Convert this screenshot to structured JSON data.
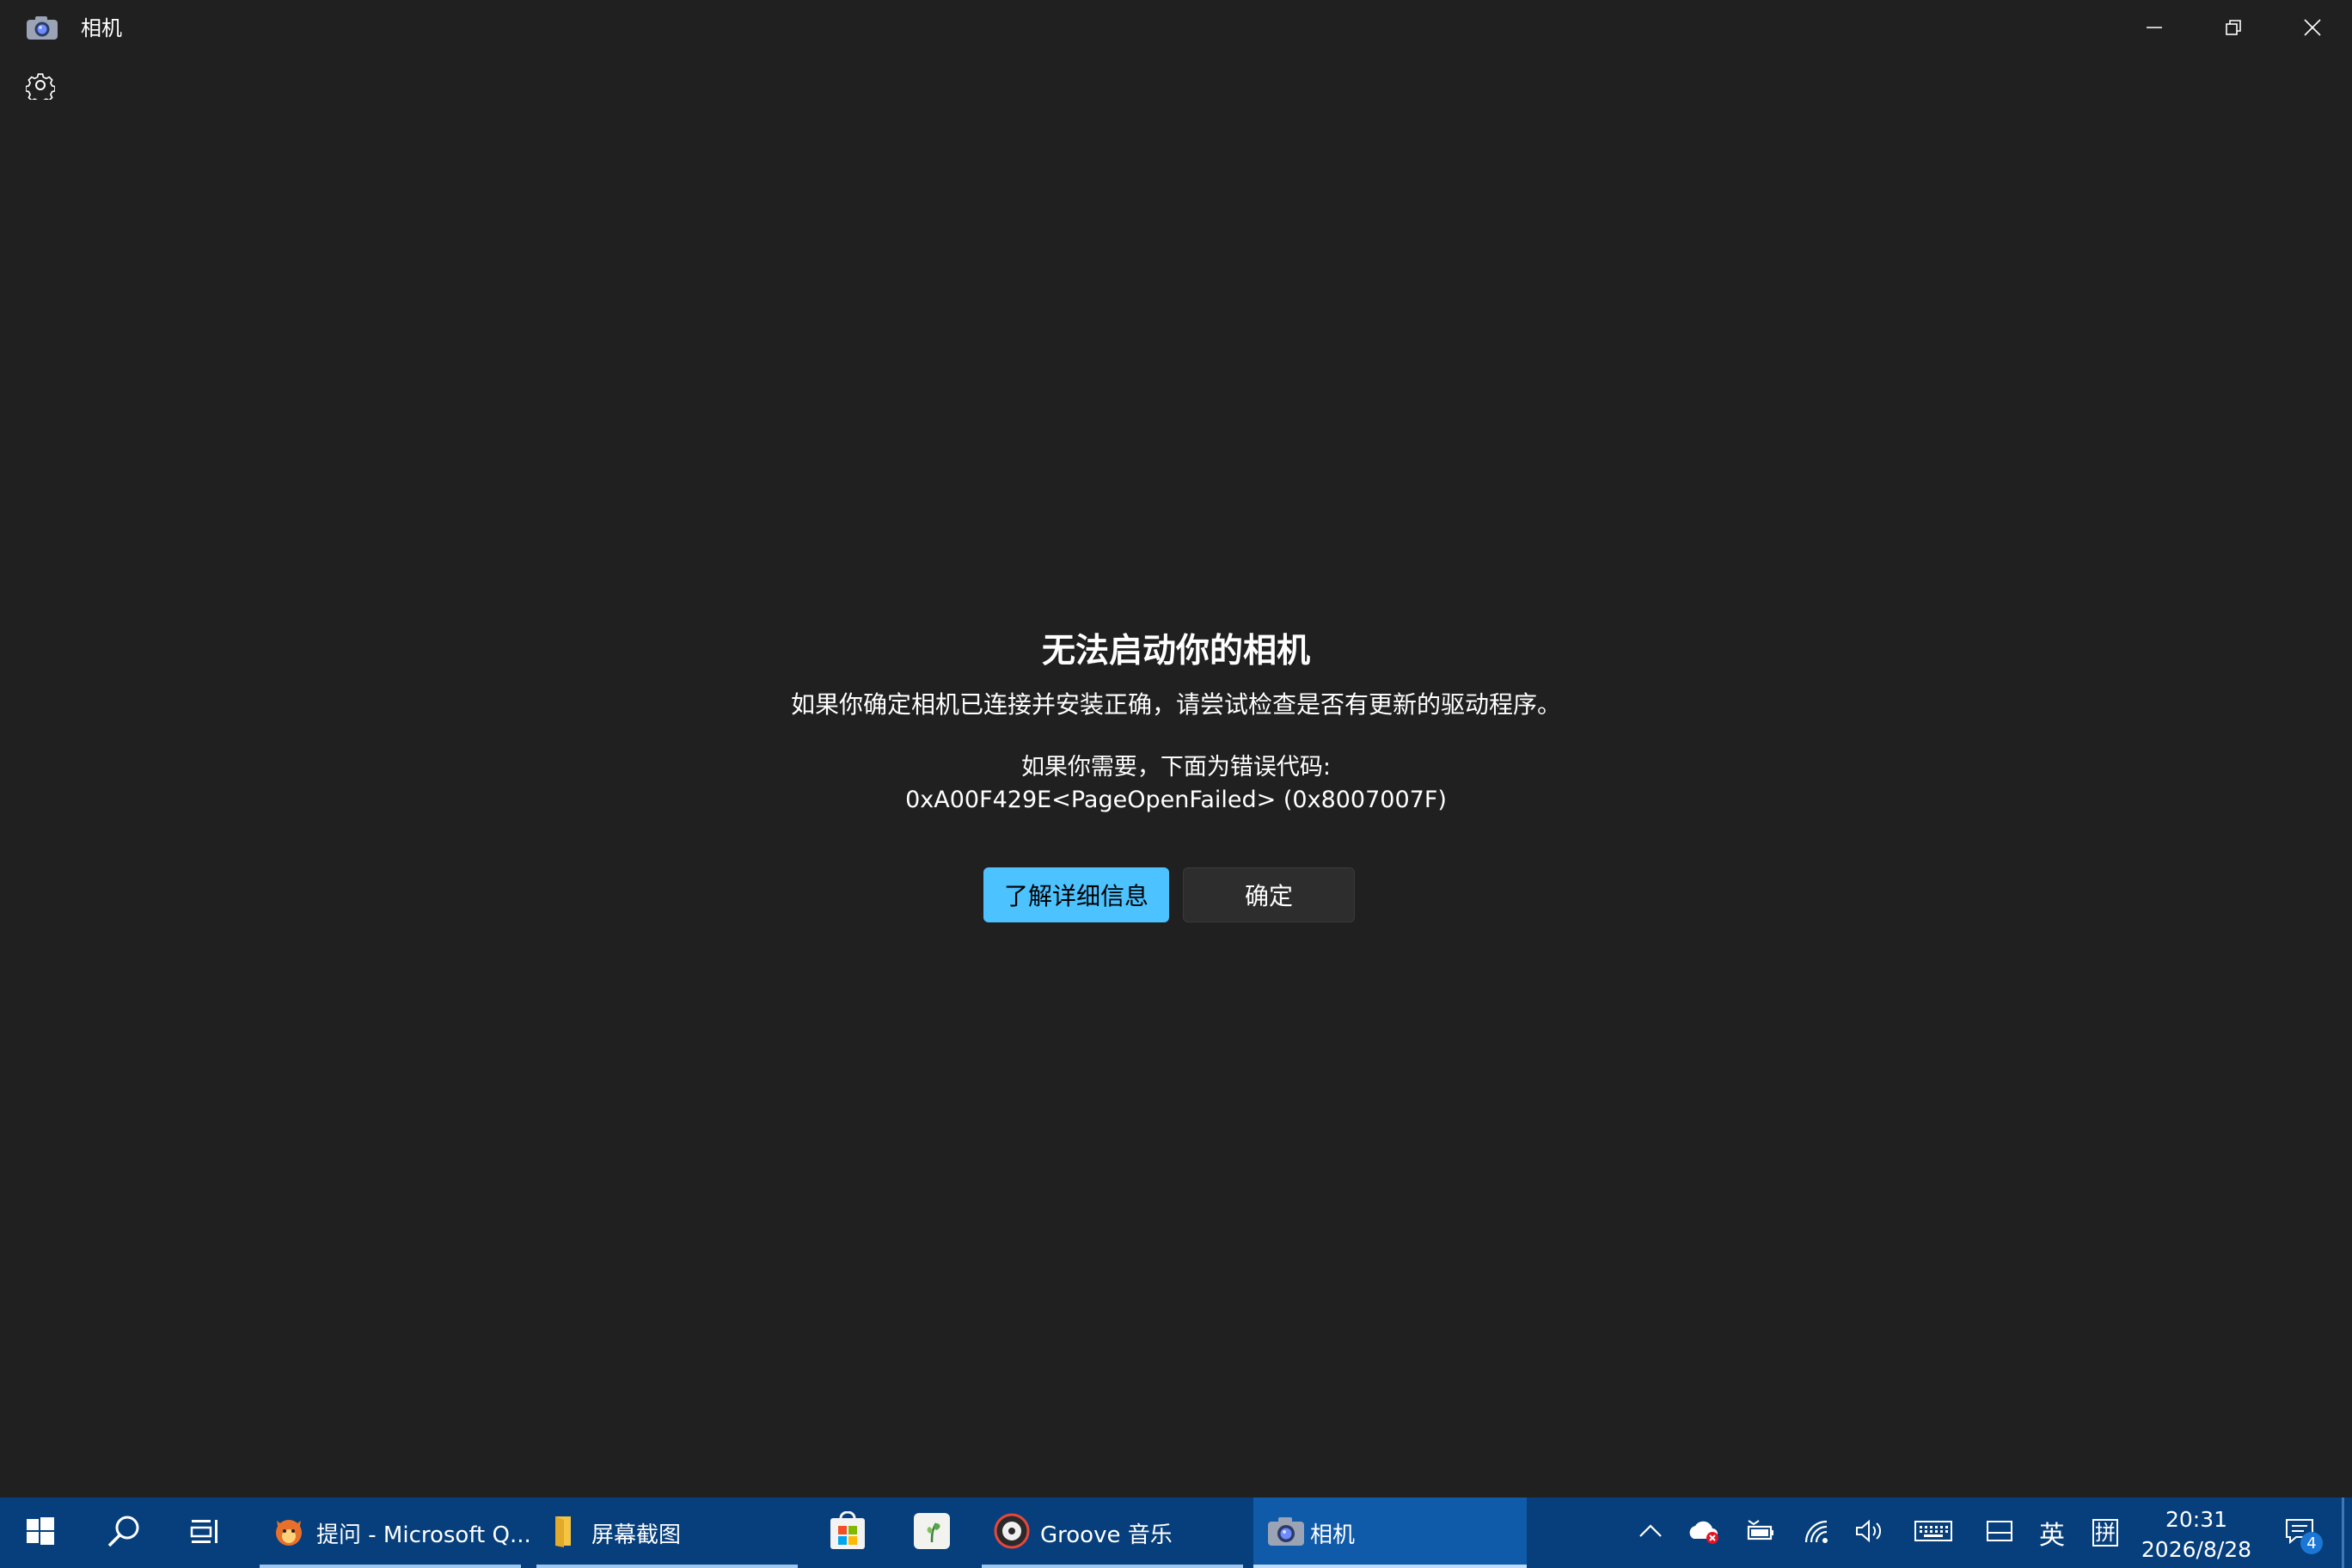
{
  "window": {
    "title": "相机",
    "minimize_icon": "minimize-icon",
    "restore_icon": "restore-icon",
    "close_icon": "close-icon",
    "settings_icon": "gear-icon"
  },
  "dialog": {
    "heading": "无法启动你的相机",
    "description": "如果你确定相机已连接并安装正确，请尝试检查是否有更新的驱动程序。",
    "error_hint": "如果你需要，下面为错误代码:",
    "error_code": "0xA00F429E<PageOpenFailed> (0x8007007F)",
    "primary_button": "了解详细信息",
    "secondary_button": "确定"
  },
  "taskbar": {
    "apps": [
      {
        "label": "提问 - Microsoft Q...",
        "icon": "edge-fox-icon"
      },
      {
        "label": "屏幕截图",
        "icon": "folder-icon"
      },
      {
        "label": "",
        "icon": "store-icon"
      },
      {
        "label": "",
        "icon": "plant-app-icon"
      },
      {
        "label": "Groove 音乐",
        "icon": "groove-music-icon"
      },
      {
        "label": "相机",
        "icon": "camera-icon"
      }
    ],
    "tray": {
      "ime_lang": "英",
      "ime_mode": "拼",
      "time": "20:31",
      "date": "2026/8/28",
      "notification_count": "4"
    }
  },
  "colors": {
    "background": "#202020",
    "accent": "#4cc2ff",
    "taskbar": "#073f7c",
    "taskbar_active": "#0f5aa9"
  }
}
